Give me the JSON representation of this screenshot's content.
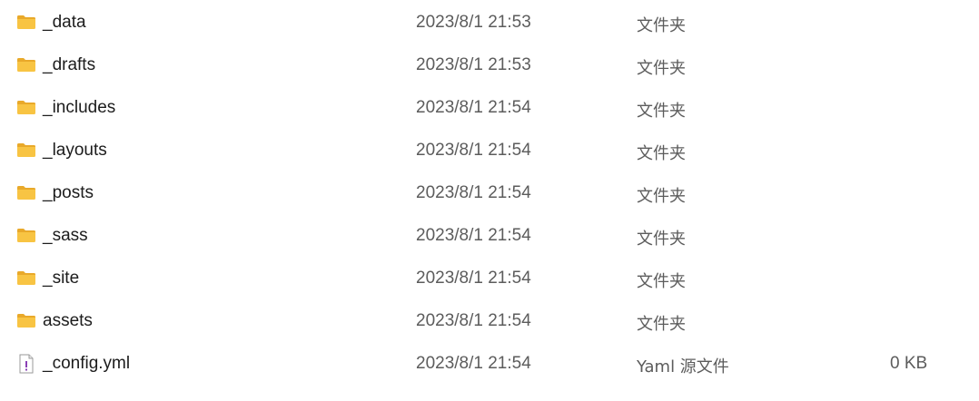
{
  "files": [
    {
      "name": "_data",
      "modified": "2023/8/1 21:53",
      "type": "文件夹",
      "size": "",
      "icon": "folder-icon"
    },
    {
      "name": "_drafts",
      "modified": "2023/8/1 21:53",
      "type": "文件夹",
      "size": "",
      "icon": "folder-icon"
    },
    {
      "name": "_includes",
      "modified": "2023/8/1 21:54",
      "type": "文件夹",
      "size": "",
      "icon": "folder-icon"
    },
    {
      "name": "_layouts",
      "modified": "2023/8/1 21:54",
      "type": "文件夹",
      "size": "",
      "icon": "folder-icon"
    },
    {
      "name": "_posts",
      "modified": "2023/8/1 21:54",
      "type": "文件夹",
      "size": "",
      "icon": "folder-icon"
    },
    {
      "name": "_sass",
      "modified": "2023/8/1 21:54",
      "type": "文件夹",
      "size": "",
      "icon": "folder-icon"
    },
    {
      "name": "_site",
      "modified": "2023/8/1 21:54",
      "type": "文件夹",
      "size": "",
      "icon": "folder-icon"
    },
    {
      "name": "assets",
      "modified": "2023/8/1 21:54",
      "type": "文件夹",
      "size": "",
      "icon": "folder-icon"
    },
    {
      "name": "_config.yml",
      "modified": "2023/8/1 21:54",
      "type": "Yaml 源文件",
      "size": "0 KB",
      "icon": "yaml-file-icon"
    }
  ],
  "colors": {
    "folder_body": "#f8c443",
    "folder_tab": "#e9a92a",
    "yaml_accent": "#8a3fb5"
  }
}
